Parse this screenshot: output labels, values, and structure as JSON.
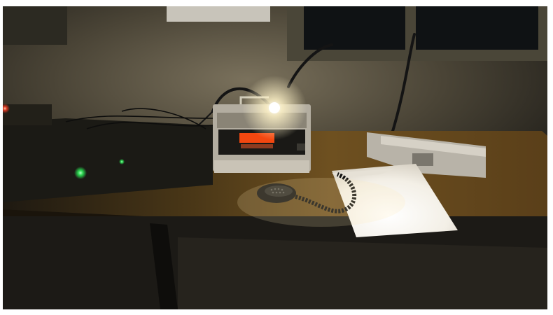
{
  "scene": {
    "subject": "radio-transceiver-on-desk",
    "colors": {
      "wall": "#3a362c",
      "wall_lit": "#6b6350",
      "desk": "#3b2c15",
      "desk_lit": "#7a5a26",
      "radio_body": "#9a9486",
      "radio_display": "#ff4a10",
      "lamp_glow": "#fff6d8",
      "paper": "#f2eee6",
      "led_green": "#2bff5a",
      "led_red": "#ff3a20",
      "window": "#0f1214",
      "cable": "#141414"
    }
  }
}
